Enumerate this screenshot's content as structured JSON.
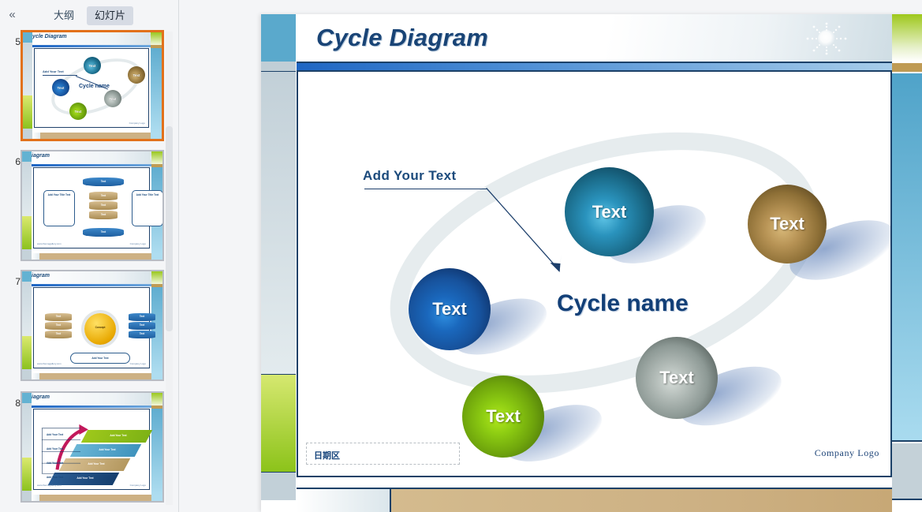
{
  "left_panel": {
    "collapse_label": "«",
    "tabs": [
      {
        "label": "大纲",
        "active": false
      },
      {
        "label": "幻灯片",
        "active": true
      }
    ],
    "thumbnails": [
      {
        "number": "5",
        "title": "Cycle Diagram",
        "selected": true,
        "labels": {
          "add_text": "Add Your Text",
          "cycle_name": "Cycle name",
          "node": "Text",
          "logo": "Company Logo"
        }
      },
      {
        "number": "6",
        "title": "Diagram",
        "selected": false,
        "labels": {
          "side_title": "Add Your Title Text",
          "bullet": "Text",
          "node": "Text",
          "url": "www.themegallery.com",
          "logo": "Company Logo"
        }
      },
      {
        "number": "7",
        "title": "Diagram",
        "selected": false,
        "labels": {
          "center": "Concept",
          "node": "Text",
          "caption": "Add Your Text",
          "url": "www.themegallery.com",
          "logo": "Company Logo"
        }
      },
      {
        "number": "8",
        "title": "Diagram",
        "selected": false,
        "labels": {
          "step": "Add Your Text",
          "row": "Add Your Text",
          "url": "www.themegallery.com",
          "logo": "Company Logo"
        }
      }
    ]
  },
  "slide": {
    "title": "Cycle Diagram",
    "add_your_text": "Add Your Text",
    "cycle_name": "Cycle name",
    "date_placeholder": "日期区",
    "company_logo": "Company  Logo",
    "icons": {
      "sun": "sun-starburst-icon"
    },
    "nodes": [
      {
        "id": "teal",
        "label": "Text",
        "color": "#1b6d8c"
      },
      {
        "id": "brown",
        "label": "Text",
        "color": "#8d6f36"
      },
      {
        "id": "blue",
        "label": "Text",
        "color": "#17529c"
      },
      {
        "id": "gray",
        "label": "Text",
        "color": "#8d9995"
      },
      {
        "id": "green",
        "label": "Text",
        "color": "#6fa50c"
      }
    ]
  },
  "theme": {
    "title_color": "#194476",
    "accent_blue": "#1e66c3",
    "accent_green": "#8cc31a",
    "accent_tan": "#cdb184",
    "border_navy": "#1c4168",
    "selection_orange": "#e2711b"
  }
}
